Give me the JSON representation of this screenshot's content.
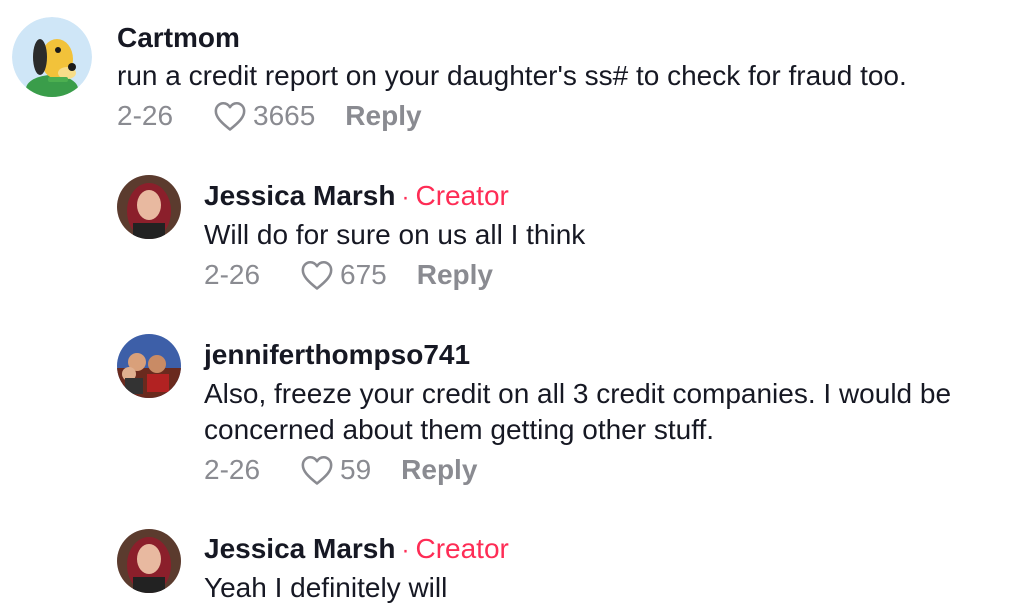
{
  "comments": [
    {
      "username": "Cartmom",
      "creator_label": "",
      "text_lines": [
        "run a credit report on your daughter's ss# to check for fraud too."
      ],
      "date": "2-26",
      "likes": "3665",
      "reply_label": "Reply",
      "avatar": "pluto-cartoon-avatar"
    },
    {
      "username": "Jessica Marsh",
      "creator_label": "Creator",
      "text_lines": [
        "Will do for sure on us all I think"
      ],
      "date": "2-26",
      "likes": "675",
      "reply_label": "Reply",
      "avatar": "woman-photo-avatar"
    },
    {
      "username": "jenniferthompso741",
      "creator_label": "",
      "text_lines": [
        "Also, freeze your credit on all 3 credit companies. I would be",
        "concerned about them getting other stuff."
      ],
      "date": "2-26",
      "likes": "59",
      "reply_label": "Reply",
      "avatar": "group-photo-avatar"
    },
    {
      "username": "Jessica Marsh",
      "creator_label": "Creator",
      "text_lines": [
        "Yeah I definitely will"
      ],
      "date": "",
      "likes": "",
      "reply_label": "",
      "avatar": "woman-photo-avatar"
    }
  ],
  "separator": "·",
  "icons": {
    "like": "heart-outline-icon"
  },
  "colors": {
    "creator": "#fe2c55",
    "meta": "#8a8b91",
    "text": "#161823"
  }
}
